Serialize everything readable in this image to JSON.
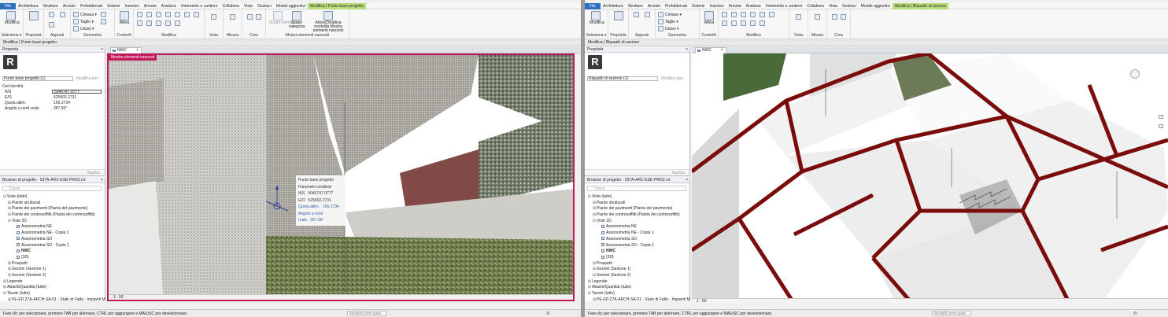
{
  "left": {
    "menu": [
      "Architettura",
      "Strutture",
      "Acciaio",
      "Prefabbricati",
      "Sistemi",
      "Inserisci",
      "Annota",
      "Analizza",
      "Volumetrie e cantiere",
      "Collabora",
      "Vista",
      "Gestisci",
      "Moduli aggiuntivi"
    ],
    "file_label": "File",
    "context_tab": "Modifica | Punto base progetto",
    "ribbon": {
      "modify": "Modifica",
      "groups": [
        "Seleziona ▾",
        "Proprietà",
        "Appunti",
        "Geometria",
        "Controlli",
        "Modifica",
        "Vista",
        "Misura",
        "Crea",
        "Mostra elementi nascosti"
      ],
      "cimasa": "Cimasa ▾",
      "taglio": "Taglio ▾",
      "unisci": "Unisci ▾",
      "attiva": "Attiva",
      "scopri_elemento": "Scopri elemento",
      "scopri_categoria": "Scopri categoria",
      "toggle": "Attiva/Disattiva modalità Mostra elementi nascosti"
    },
    "subbar": "Modifica | Punto base progetto",
    "properties": {
      "title": "Proprietà",
      "close": "×",
      "type": "Punto base progetto (1)",
      "edit_type": "Modifica tipo",
      "section": "Dati identità",
      "rows": [
        {
          "k": "N/S",
          "v": "5046747.0777",
          "box": true
        },
        {
          "k": "E/O",
          "v": "525502.2731",
          "box": false
        },
        {
          "k": "Quota altim.",
          "v": "156.2734",
          "box": false
        },
        {
          "k": "Angolo a nord reale",
          "v": "357.56°",
          "box": false
        }
      ],
      "apply": "Applica"
    },
    "browser": {
      "title": "Browser di progetto - 037A-ARC-ESE-PRO2.rvt",
      "close": "×",
      "search": "Cerca",
      "items": [
        {
          "t": "⊟",
          "label": "Viste (tutto)",
          "lvl": 0,
          "icon": false,
          "bold": false
        },
        {
          "t": "⊞",
          "label": "Piante strutturali",
          "lvl": 1,
          "icon": false,
          "bold": false
        },
        {
          "t": "⊞",
          "label": "Piante dei pavimenti (Pianta del pavimento)",
          "lvl": 1,
          "icon": false,
          "bold": false
        },
        {
          "t": "⊞",
          "label": "Piante dei controsoffitti (Pianta dei controsoffitti)",
          "lvl": 1,
          "icon": false,
          "bold": false
        },
        {
          "t": "⊟",
          "label": "Viste 3D",
          "lvl": 1,
          "icon": false,
          "bold": false
        },
        {
          "t": "",
          "label": "Assonometria NE",
          "lvl": 2,
          "icon": true,
          "bold": false
        },
        {
          "t": "",
          "label": "Assonometria NE - Copia 1",
          "lvl": 2,
          "icon": true,
          "bold": false
        },
        {
          "t": "",
          "label": "Assonometria SO",
          "lvl": 2,
          "icon": true,
          "bold": false
        },
        {
          "t": "",
          "label": "Assonometria SO - Copia 1",
          "lvl": 2,
          "icon": true,
          "bold": false
        },
        {
          "t": "",
          "label": "NWC",
          "lvl": 2,
          "icon": true,
          "bold": true
        },
        {
          "t": "",
          "label": "{3D}",
          "lvl": 2,
          "icon": true,
          "bold": false
        },
        {
          "t": "⊞",
          "label": "Prospetti",
          "lvl": 1,
          "icon": false,
          "bold": false
        },
        {
          "t": "⊞",
          "label": "Sezioni (Sezione 1)",
          "lvl": 1,
          "icon": false,
          "bold": false
        },
        {
          "t": "⊞",
          "label": "Sezioni (Sezione 2)",
          "lvl": 1,
          "icon": false,
          "bold": false
        },
        {
          "t": "⊞",
          "label": "Legende",
          "lvl": 0,
          "icon": false,
          "bold": false
        },
        {
          "t": "⊞",
          "label": "Abachi/Quantità (tutto)",
          "lvl": 0,
          "icon": false,
          "bold": false
        },
        {
          "t": "⊟",
          "label": "Tavole (tutto)",
          "lvl": 0,
          "icon": false,
          "bold": false
        },
        {
          "t": "⊞",
          "label": "PE-ED.27A-ARCH-SA-01 - Stato di Fatto - Impianti M",
          "lvl": 1,
          "icon": false,
          "bold": false
        }
      ]
    },
    "tab_label": "NWC",
    "tab_close": "×",
    "hidden_banner": "Mostra elementi nascosti",
    "tooltip": {
      "title": "Punto base progetto",
      "subtitle": "Parametri condivisi",
      "rows": [
        [
          "N/S",
          "5046747.0777"
        ],
        [
          "E/O",
          "525502.2731"
        ],
        [
          "Quota altim.",
          "156.2734"
        ],
        [
          "Angolo a nord reale",
          "357.56°"
        ]
      ]
    },
    "scale": "1 : 50",
    "status": "Fare clic per selezionare, premere TAB per alternare, CTRL per aggiungere e MAIUSC per deselezionare.",
    "model": "Modello principale",
    "filter_count": ":0"
  },
  "right": {
    "context_tab": "Modifica | Riquadri di sezione",
    "subbar": "Modifica | Riquadri di sezione",
    "type": "Riquadri di sezione (1)",
    "browser_items_override": "Assonometria SO - Copia 1",
    "status": "Fare clic per selezionare, premere TAB per alternare, CTRL per aggiungere e MAIUSC per deselezionare.",
    "model": "Modello principale",
    "filter_count": ":0"
  },
  "colors": {
    "accent": "#2f6fbf",
    "context": "#b9dc7a",
    "selection_frame": "#c2185b",
    "wall_red": "#7a0c0c"
  }
}
